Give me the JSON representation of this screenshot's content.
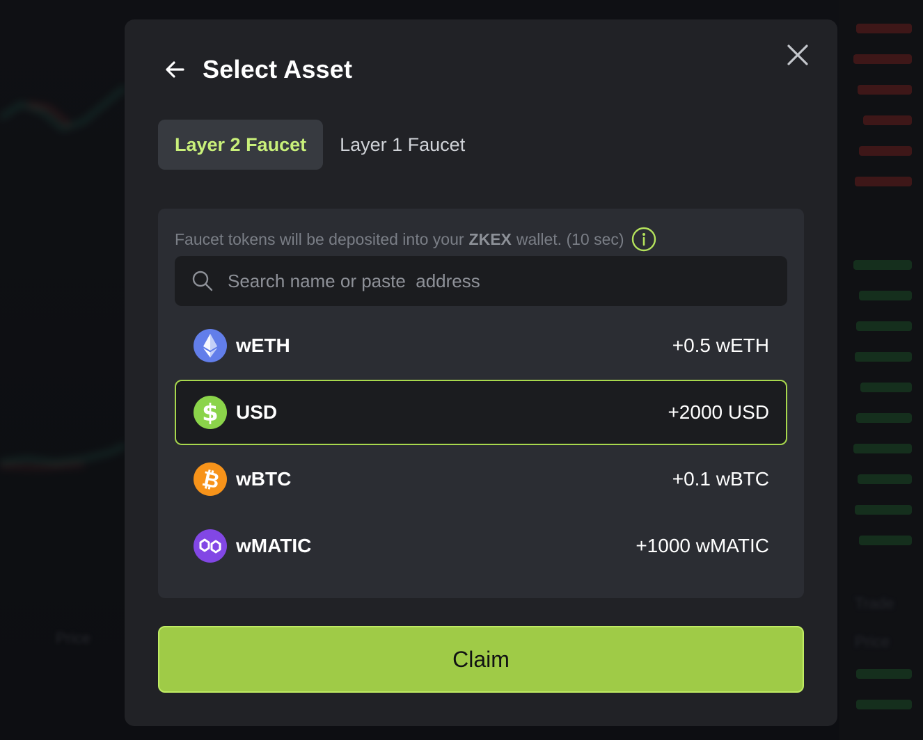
{
  "modal": {
    "title": "Select Asset"
  },
  "tabs": [
    {
      "label": "Layer 2 Faucet",
      "active": true
    },
    {
      "label": "Layer 1 Faucet",
      "active": false
    }
  ],
  "notice": {
    "prefix": "Faucet tokens will be deposited into your",
    "brand": "ZKEX",
    "suffix": "wallet. (10 sec)"
  },
  "search": {
    "placeholder": "Search name or paste  address",
    "value": ""
  },
  "assets": [
    {
      "name": "wETH",
      "amount": "+0.5 wETH",
      "icon": "ethereum-icon",
      "color": "#627eea",
      "selected": false
    },
    {
      "name": "USD",
      "amount": "+2000 USD",
      "icon": "dollar-icon",
      "color": "#8bd44a",
      "selected": true
    },
    {
      "name": "wBTC",
      "amount": "+0.1 wBTC",
      "icon": "bitcoin-icon",
      "color": "#f7931a",
      "selected": false
    },
    {
      "name": "wMATIC",
      "amount": "+1000 wMATIC",
      "icon": "polygon-icon",
      "color": "#8247e5",
      "selected": false
    }
  ],
  "claim_button": {
    "label": "Claim"
  },
  "colors": {
    "accent": "#a8d84d",
    "modal_bg": "#212226",
    "panel_bg": "#2b2d33",
    "button_bg": "#9fcb47"
  },
  "background": {
    "price_label": "Price",
    "trade_label": "Trade"
  }
}
